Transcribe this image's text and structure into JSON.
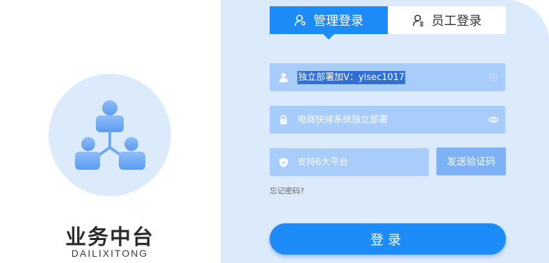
{
  "brand": {
    "title": "业务中台",
    "subtitle": "DAILIXITONG",
    "icon": "org-structure-icon"
  },
  "tabs": [
    {
      "label": "管理登录",
      "icon": "user-settings-icon",
      "active": true
    },
    {
      "label": "员工登录",
      "icon": "user-staff-icon",
      "active": false
    }
  ],
  "form": {
    "username": {
      "value": "独立部署加V：ylsec1017",
      "icon": "user-icon",
      "trail_icon": "clear-icon"
    },
    "password": {
      "placeholder": "电商快排系统独立部署",
      "icon": "lock-icon",
      "trail_icon": "eye-icon"
    },
    "captcha": {
      "placeholder": "支持6大平台",
      "icon": "shield-icon"
    },
    "send_code_label": "发送验证码",
    "forgot_label": "忘记密码?",
    "login_label": "登录"
  },
  "colors": {
    "primary": "#1d8cf8",
    "panel_bg": "#dcebfc",
    "input_bg": "#a9cdfb",
    "send_code_bg": "#7db3f6"
  }
}
